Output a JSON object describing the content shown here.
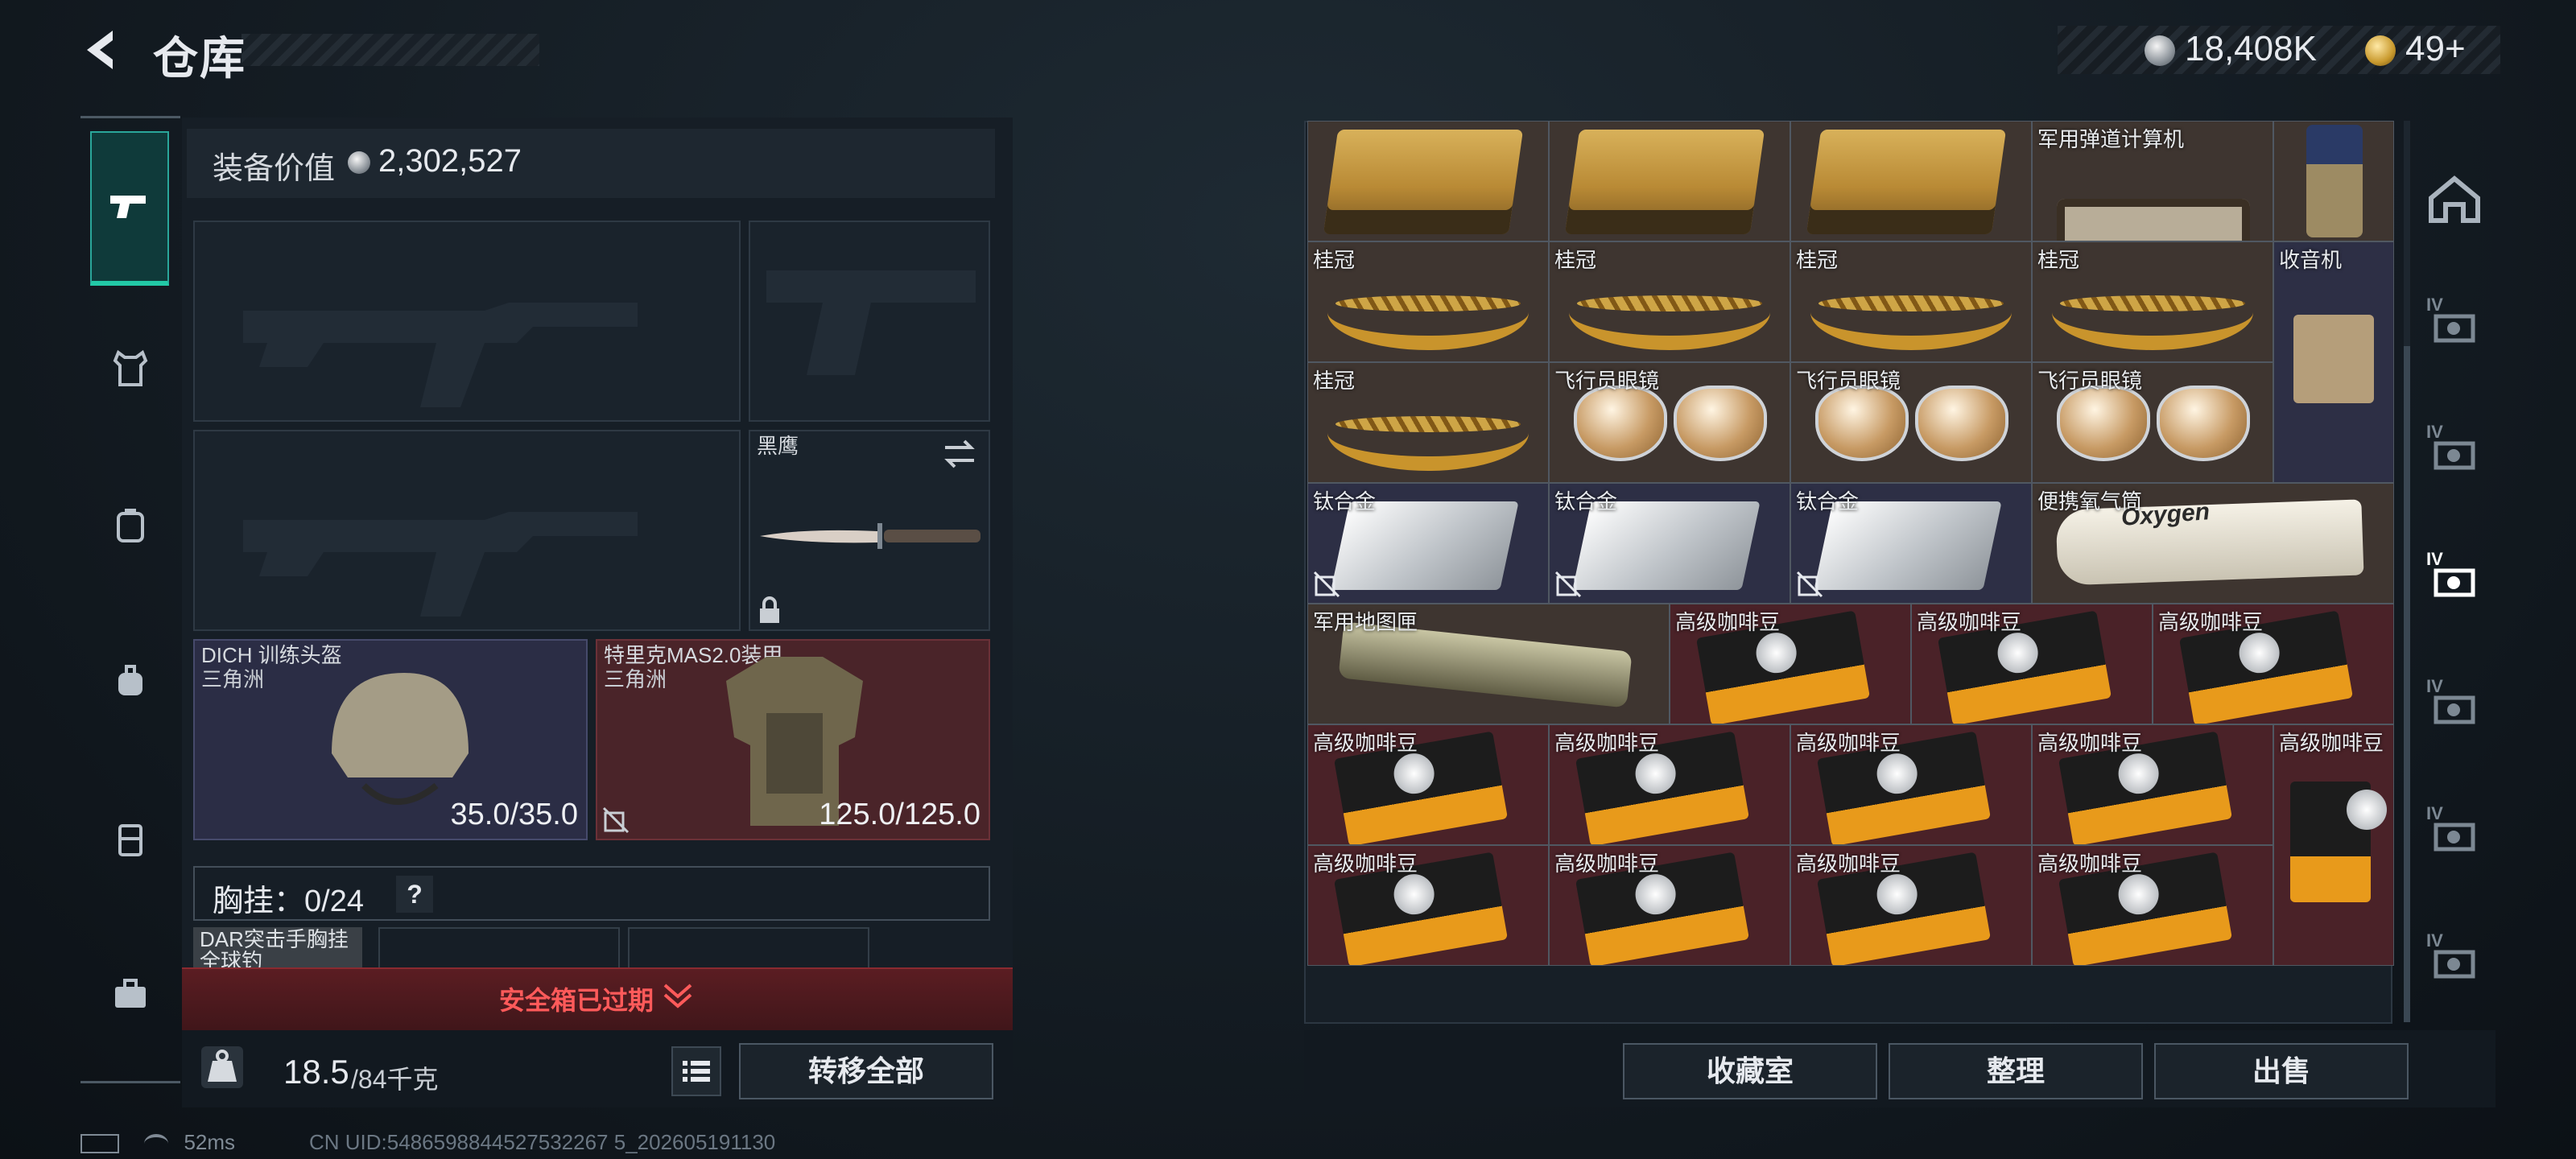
{
  "header": {
    "title": "仓库",
    "currency_silver": "18,408K",
    "currency_gold": "49+"
  },
  "loadout": {
    "equip_value_label": "装备价值",
    "equip_value": "2,302,527",
    "melee_label": "黑鹰",
    "helmet": {
      "name": "DICH 训练头盔",
      "sub": "三角洲",
      "durability": "35.0/35.0"
    },
    "armor": {
      "name": "特里克MAS2.0装甲",
      "sub": "三角洲",
      "durability": "125.0/125.0"
    },
    "chest_rig_label": "胸挂：0/24",
    "chest_help": "?",
    "rig_item": "DAR突击手胸挂",
    "rig_item_sub": "全球钓"
  },
  "safe_box": {
    "text": "安全箱已过期"
  },
  "weight": {
    "current": "18.5",
    "max": "/84千克"
  },
  "buttons": {
    "transfer_all": "转移全部",
    "collection": "收藏室",
    "sort": "整理",
    "sell": "出售"
  },
  "status": {
    "ping": "52ms",
    "uid": "CN UID:5486598844527532267 5_202605191130"
  },
  "stash": {
    "items": [
      {
        "label": "",
        "kind": "crate"
      },
      {
        "label": "",
        "kind": "crate"
      },
      {
        "label": "",
        "kind": "crate"
      },
      {
        "label": "军用弹道计算机",
        "kind": "computer"
      },
      {
        "label": "",
        "kind": "radio-device"
      },
      {
        "label": "桂冠",
        "kind": "laurel"
      },
      {
        "label": "桂冠",
        "kind": "laurel"
      },
      {
        "label": "桂冠",
        "kind": "laurel"
      },
      {
        "label": "桂冠",
        "kind": "laurel"
      },
      {
        "label": "收音机",
        "kind": "radio"
      },
      {
        "label": "桂冠",
        "kind": "laurel"
      },
      {
        "label": "飞行员眼镜",
        "kind": "shades"
      },
      {
        "label": "飞行员眼镜",
        "kind": "shades"
      },
      {
        "label": "飞行员眼镜",
        "kind": "shades"
      },
      {
        "label": "钛合金",
        "kind": "ingot"
      },
      {
        "label": "钛合金",
        "kind": "ingot"
      },
      {
        "label": "钛合金",
        "kind": "ingot"
      },
      {
        "label": "便携氧气筒",
        "kind": "oxygen",
        "text": "Oxygen"
      },
      {
        "label": "军用地图匣",
        "kind": "tube"
      },
      {
        "label": "高级咖啡豆",
        "kind": "coffee"
      },
      {
        "label": "高级咖啡豆",
        "kind": "coffee"
      },
      {
        "label": "高级咖啡豆",
        "kind": "coffee"
      },
      {
        "label": "高级咖啡豆",
        "kind": "coffee"
      },
      {
        "label": "高级咖啡豆",
        "kind": "coffee"
      },
      {
        "label": "高级咖啡豆",
        "kind": "coffee"
      },
      {
        "label": "高级咖啡豆",
        "kind": "coffee"
      },
      {
        "label": "高级咖啡豆",
        "kind": "coffee-tall"
      },
      {
        "label": "高级咖啡豆",
        "kind": "coffee"
      },
      {
        "label": "高级咖啡豆",
        "kind": "coffee"
      },
      {
        "label": "高级咖啡豆",
        "kind": "coffee"
      },
      {
        "label": "高级咖啡豆",
        "kind": "coffee"
      }
    ]
  },
  "sidebar_right": {
    "tab_label": "IV"
  }
}
